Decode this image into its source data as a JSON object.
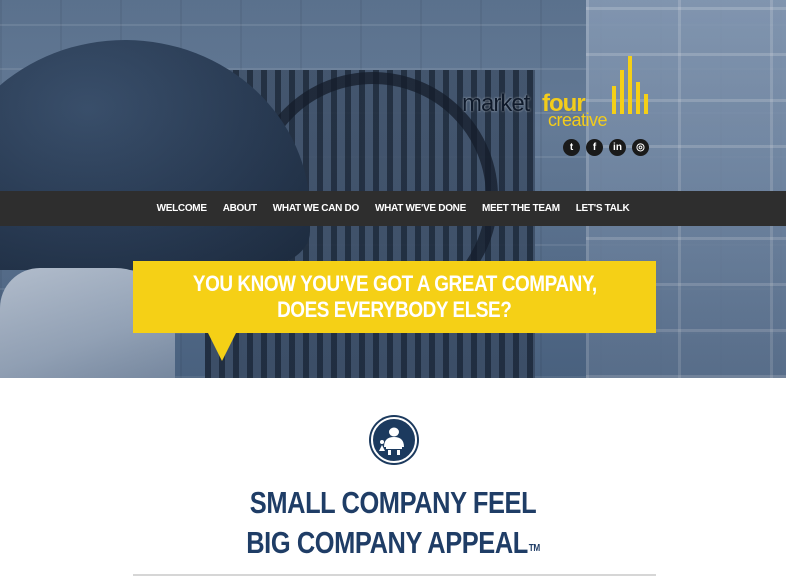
{
  "brand": {
    "logo_word_market": "market",
    "logo_word_four": "four",
    "logo_word_creative": "creative",
    "accent_color": "#f5d016",
    "dark_color": "#1f3d66"
  },
  "social": [
    {
      "icon": "twitter-icon",
      "glyph": "t"
    },
    {
      "icon": "facebook-icon",
      "glyph": "f"
    },
    {
      "icon": "linkedin-icon",
      "glyph": "in"
    },
    {
      "icon": "instagram-icon",
      "glyph": "◎"
    }
  ],
  "nav": {
    "items": [
      "WELCOME",
      "ABOUT",
      "WHAT WE CAN DO",
      "WHAT WE'VE DONE",
      "MEET THE TEAM",
      "LET'S TALK"
    ]
  },
  "hero": {
    "callout_line1": "YOU KNOW YOU'VE GOT A GREAT COMPANY,",
    "callout_line2": "DOES EVERYBODY ELSE?"
  },
  "section": {
    "icon": "small-big-company-icon",
    "headline_line1": "SMALL COMPANY FEEL",
    "headline_line2": "BIG COMPANY APPEAL",
    "trademark": "TM"
  }
}
